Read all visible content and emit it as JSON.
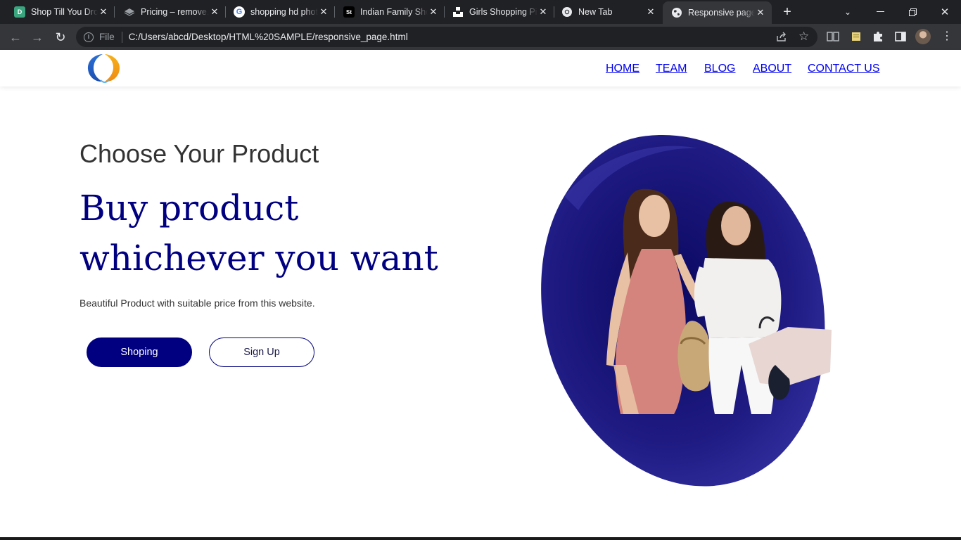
{
  "browser": {
    "tabs": [
      {
        "title": "Shop Till You Drop",
        "favicon": "d-icon"
      },
      {
        "title": "Pricing – remove.bg",
        "favicon": "layers-icon"
      },
      {
        "title": "shopping hd photos",
        "favicon": "google-icon"
      },
      {
        "title": "Indian Family Shopping",
        "favicon": "st-icon"
      },
      {
        "title": "Girls Shopping Pictures",
        "favicon": "unsplash-icon"
      },
      {
        "title": "New Tab",
        "favicon": "chrome-icon"
      },
      {
        "title": "Responsive page",
        "favicon": "globe-icon"
      }
    ],
    "address": {
      "scheme_label": "File",
      "url": "C:/Users/abcd/Desktop/HTML%20SAMPLE/responsive_page.html"
    }
  },
  "site": {
    "nav": [
      "HOME",
      "TEAM",
      "BLOG",
      "ABOUT",
      "CONTACT US"
    ],
    "hero": {
      "subheading": "Choose Your Product",
      "headline_line1": "Buy product",
      "headline_line2": "whichever you want",
      "description": "Beautiful Product with suitable price from this website.",
      "primary_button": "Shoping",
      "secondary_button": "Sign Up"
    }
  },
  "colors": {
    "accent": "#000080",
    "blob": "#26238f",
    "chrome_dark": "#202124",
    "chrome_mid": "#35363a"
  }
}
